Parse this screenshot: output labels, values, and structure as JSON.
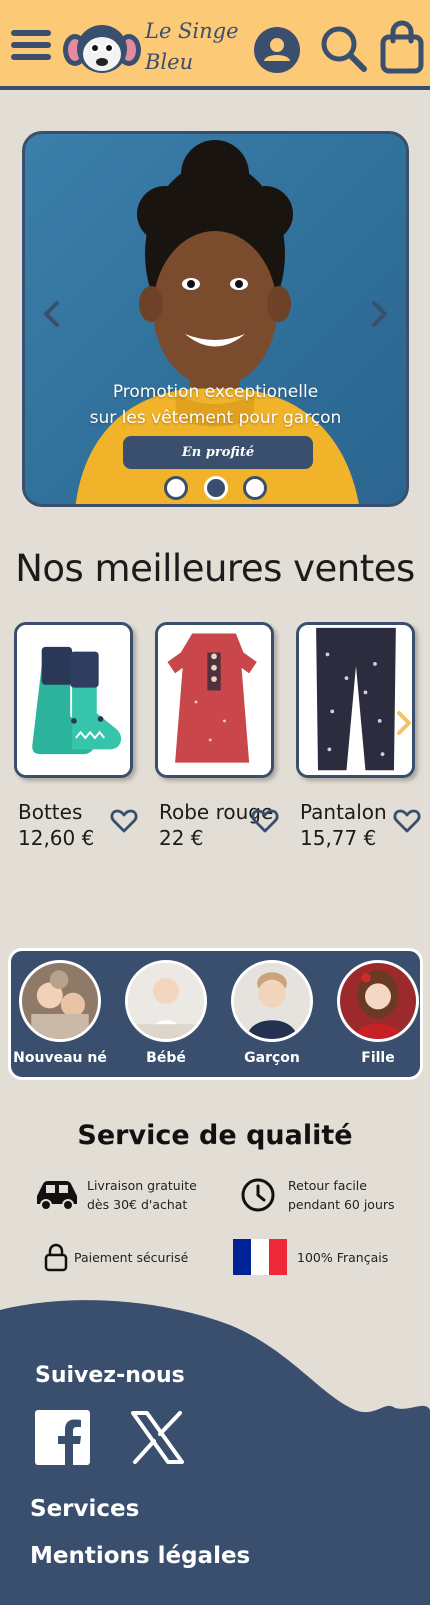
{
  "brand": {
    "name_line1": "Le Singe",
    "name_line2": "Bleu",
    "colors": {
      "primary": "#3a4f6d",
      "header": "#fcc976",
      "background": "#e3ded5",
      "accent_arrow": "#f2c463"
    }
  },
  "header": {
    "icons": [
      "menu-icon",
      "monkey-logo",
      "account-icon",
      "search-icon",
      "shopping-bag-icon"
    ]
  },
  "hero": {
    "line1": "Promotion exceptionelle",
    "line2": "sur les vêtement pour garçon",
    "cta_label": "En profité",
    "slides_count": 3,
    "active_slide": 2
  },
  "best_sellers": {
    "title": "Nos meilleures ventes",
    "products": [
      {
        "name": "Bottes",
        "price": "12,60 €"
      },
      {
        "name": "Robe rouge",
        "price": "22 €"
      },
      {
        "name": "Pantalon",
        "price": "15,77 €"
      }
    ]
  },
  "categories": [
    {
      "label": "Nouveau né"
    },
    {
      "label": "Bébé"
    },
    {
      "label": "Garçon"
    },
    {
      "label": "Fille"
    }
  ],
  "quality": {
    "title": "Service de qualité",
    "delivery_line1": "Livraison gratuite",
    "delivery_line2": "dès 30€ d'achat",
    "return_line1": "Retour facile",
    "return_line2": "pendant 60 jours",
    "payment": "Paiement sécurisé",
    "french": "100% Français"
  },
  "footer": {
    "follow": "Suivez-nous",
    "links": [
      "Services",
      "Mentions légales"
    ]
  }
}
